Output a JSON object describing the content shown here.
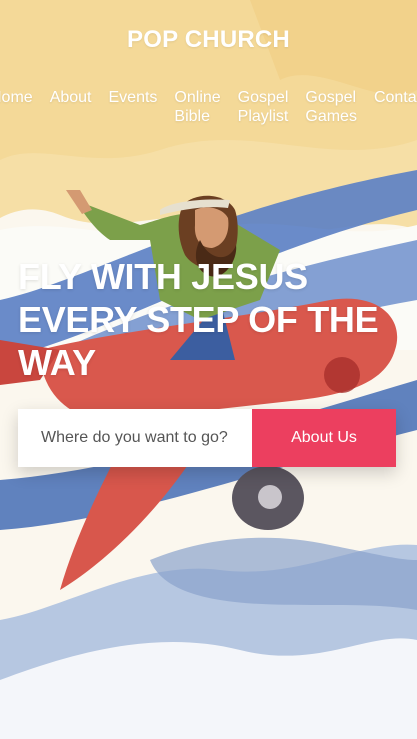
{
  "site": {
    "brand": "POP CHURCH"
  },
  "nav": {
    "items": [
      {
        "label": "Home"
      },
      {
        "label": "About"
      },
      {
        "label": "Events"
      },
      {
        "label": "Online Bible"
      },
      {
        "label": "Gospel Playlist"
      },
      {
        "label": "Gospel Games"
      },
      {
        "label": "Contact"
      }
    ]
  },
  "hero": {
    "headline": "FLY WITH JESUS EVERY STEP OF THE WAY"
  },
  "search": {
    "placeholder": "Where do you want to go?",
    "button_label": "About Us"
  },
  "colors": {
    "accent": "#ec3f5f",
    "sky_yellow": "#f6dea4",
    "ribbon_blue": "#5f82c2",
    "plane_red": "#d9584d"
  }
}
